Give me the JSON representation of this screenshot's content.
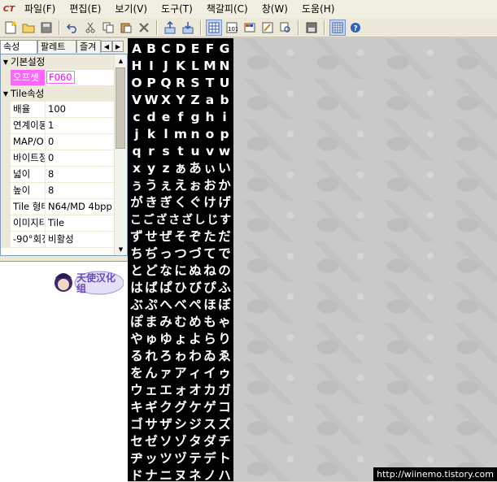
{
  "menubar": {
    "logo": "CT",
    "items": [
      "파일(F)",
      "편집(E)",
      "보기(V)",
      "도구(T)",
      "책갈피(C)",
      "창(W)",
      "도움(H)"
    ]
  },
  "toolbar": {
    "buttons": [
      {
        "icon": "new-document-icon"
      },
      {
        "icon": "open-folder-icon"
      },
      {
        "icon": "save-icon"
      },
      {
        "icon": "undo-icon"
      },
      {
        "icon": "cut-icon"
      },
      {
        "icon": "copy-icon"
      },
      {
        "icon": "paste-icon"
      },
      {
        "icon": "delete-icon"
      },
      {
        "icon": "import-icon"
      },
      {
        "icon": "export-icon"
      },
      {
        "icon": "tile-view-icon",
        "active": true
      },
      {
        "icon": "numeric-view-icon"
      },
      {
        "icon": "palette-icon"
      },
      {
        "icon": "edit-icon"
      },
      {
        "icon": "search-icon"
      },
      {
        "icon": "disk-icon"
      },
      {
        "icon": "grid-icon",
        "active": true
      },
      {
        "icon": "help-icon"
      }
    ]
  },
  "tabs": [
    "속성",
    "팔레트",
    "즐겨"
  ],
  "properties": {
    "basic_category": "기본설정",
    "offset": {
      "name": "오프셋",
      "value": "F060"
    },
    "tile_category": "Tile속성",
    "rows": [
      {
        "name": "배율",
        "value": "100"
      },
      {
        "name": "연계이동",
        "value": "1"
      },
      {
        "name": "MAP/O",
        "value": "0"
      },
      {
        "name": "바이트정",
        "value": "0"
      },
      {
        "name": "넓이",
        "value": "8"
      },
      {
        "name": "높이",
        "value": "8"
      },
      {
        "name": "Tile 형태",
        "value": "N64/MD 4bpp"
      },
      {
        "name": "이미지타",
        "value": "Tile"
      },
      {
        "name": "-90°회전",
        "value": "비활성"
      }
    ]
  },
  "logo_text": "天使汉化组",
  "tile_rows": [
    "ABCDEFG",
    "HIJKLMN",
    "OPQRSTU",
    "VWXYZab",
    "cdefghi",
    "jklmnop",
    "qrstuvw",
    "xyzぁあぃい",
    "ぅうぇえぉおか",
    "がきぎくぐけげ",
    "こござさざしじす",
    "ずせぜそぞただ",
    "ちぢっつづてで",
    "とどなにぬねの",
    "はばぱひびぴふ",
    "ぶぷへべぺほぼ",
    "ぽまみむめもゃ",
    "やゅゆょよらり",
    "るれろゎわゐゑ",
    "をんァアィイゥ",
    "ウェエォオカガ",
    "キギクグケゲコ",
    "ゴサザシジスズ",
    "セゼソゾタダチ",
    "ヂッツヅテデト",
    "ドナニヌネノハ"
  ],
  "watermark": "http://wiinemo.tistory.com"
}
